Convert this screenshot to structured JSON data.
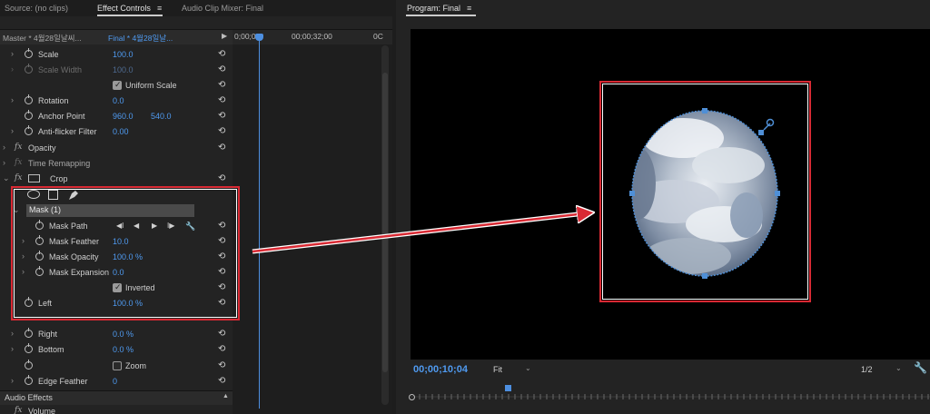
{
  "tabs": {
    "source": "Source: (no clips)",
    "effect_controls": "Effect Controls",
    "audio_mixer": "Audio Clip Mixer: Final",
    "menu_glyph": "≡"
  },
  "ec_header": {
    "master": "Master * 4월28일날씨...",
    "sequence": "Final * 4월28일날...",
    "play": "▶"
  },
  "timeline": {
    "tc_start": "0;00;0",
    "tc_mid": "00;00;32;00",
    "tc_end": "0C"
  },
  "rows": {
    "scale": {
      "label": "Scale",
      "value": "100.0"
    },
    "scale_width": {
      "label": "Scale Width",
      "value": "100.0"
    },
    "uniform_scale": {
      "label": "Uniform Scale"
    },
    "rotation": {
      "label": "Rotation",
      "value": "0.0"
    },
    "anchor_point": {
      "label": "Anchor Point",
      "x": "960.0",
      "y": "540.0"
    },
    "anti_flicker": {
      "label": "Anti-flicker Filter",
      "value": "0.00"
    },
    "opacity": {
      "label": "Opacity"
    },
    "time_remap": {
      "label": "Time Remapping"
    },
    "crop": {
      "label": "Crop"
    },
    "mask": {
      "label": "Mask (1)"
    },
    "mask_path": {
      "label": "Mask Path"
    },
    "mask_feather": {
      "label": "Mask Feather",
      "value": "10.0"
    },
    "mask_opacity": {
      "label": "Mask Opacity",
      "value": "100.0 %"
    },
    "mask_expansion": {
      "label": "Mask Expansion",
      "value": "0.0"
    },
    "inverted": {
      "label": "Inverted"
    },
    "left": {
      "label": "Left",
      "value": "100.0 %"
    },
    "right": {
      "label": "Right",
      "value": "0.0 %"
    },
    "bottom": {
      "label": "Bottom",
      "value": "0.0 %"
    },
    "zoom": {
      "label": "Zoom"
    },
    "edge_feather": {
      "label": "Edge Feather",
      "value": "0"
    }
  },
  "glyphs": {
    "fx": "fx",
    "caret_right": "›",
    "caret_down": "⌄",
    "reset": "⟲",
    "prev_key": "◀I",
    "prev": "◀",
    "play": "▶",
    "next_key": "I▶",
    "wrench": "🔧",
    "collapse": "▲",
    "dropdown": "⌄"
  },
  "audio_effects": {
    "label": "Audio Effects",
    "volume": "Volume"
  },
  "program": {
    "title": "Program: Final",
    "timecode": "00;00;10;04",
    "fit": "Fit",
    "resolution": "1/2"
  },
  "colors": {
    "accent_blue": "#4f9af0",
    "highlight_red": "#d92a34",
    "panel_bg": "#232323"
  }
}
